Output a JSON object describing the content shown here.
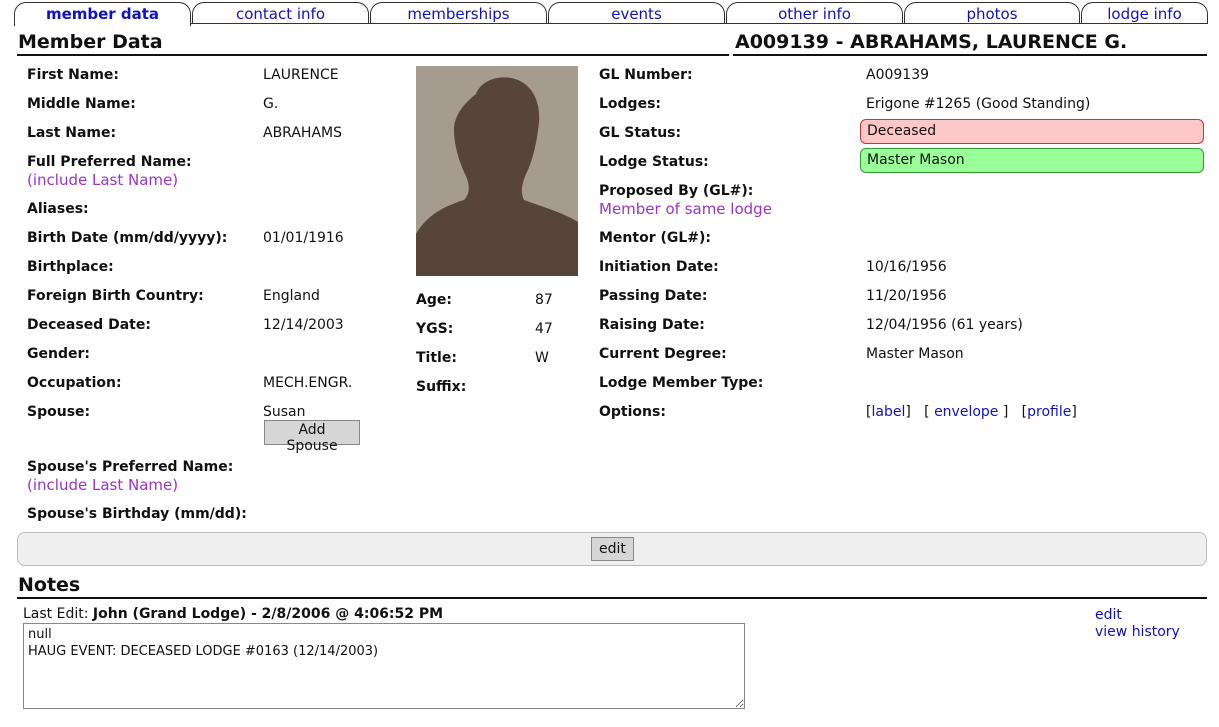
{
  "tabs": [
    {
      "label": "member data",
      "active": true
    },
    {
      "label": "contact info",
      "active": false
    },
    {
      "label": "memberships",
      "active": false
    },
    {
      "label": "events",
      "active": false
    },
    {
      "label": "other info",
      "active": false
    },
    {
      "label": "photos",
      "active": false
    },
    {
      "label": "lodge info",
      "active": false
    }
  ],
  "header": {
    "section_title": "Member Data",
    "member_title": "A009139 - ABRAHAMS, LAURENCE G."
  },
  "left": {
    "first_name_label": "First Name:",
    "first_name": "LAURENCE",
    "middle_name_label": "Middle Name:",
    "middle_name": "G.",
    "last_name_label": "Last Name:",
    "last_name": "ABRAHAMS",
    "full_pref_label": "Full Preferred Name:",
    "full_pref_hint": "(include Last Name)",
    "aliases_label": "Aliases:",
    "birth_date_label": "Birth Date (mm/dd/yyyy):",
    "birth_date": "01/01/1916",
    "birthplace_label": "Birthplace:",
    "foreign_country_label": "Foreign Birth Country:",
    "foreign_country": "England",
    "deceased_label": "Deceased Date:",
    "deceased_date": "12/14/2003",
    "gender_label": "Gender:",
    "occupation_label": "Occupation:",
    "occupation": "MECH.ENGR.",
    "spouse_label": "Spouse:",
    "spouse": "Susan",
    "add_spouse_button": "Add Spouse",
    "spouse_pref_label": "Spouse's Preferred Name:",
    "spouse_pref_hint": "(include Last Name)",
    "spouse_bday_label": "Spouse's Birthday (mm/dd):"
  },
  "middle": {
    "age_label": "Age:",
    "age": "87",
    "ygs_label": "YGS:",
    "ygs": "47",
    "title_label": "Title:",
    "title": "W",
    "suffix_label": "Suffix:"
  },
  "right": {
    "gl_number_label": "GL Number:",
    "gl_number": "A009139",
    "lodges_label": "Lodges:",
    "lodges": "Erigone #1265 (Good Standing)",
    "gl_status_label": "GL Status:",
    "gl_status": "Deceased",
    "lodge_status_label": "Lodge Status:",
    "lodge_status": "Master Mason",
    "proposed_label": "Proposed By (GL#):",
    "proposed_hint": "Member of same lodge",
    "mentor_label": "Mentor (GL#):",
    "initiation_label": "Initiation Date:",
    "initiation": "10/16/1956",
    "passing_label": "Passing Date:",
    "passing": "11/20/1956",
    "raising_label": "Raising Date:",
    "raising": "12/04/1956 (61 years)",
    "degree_label": "Current Degree:",
    "degree": "Master Mason",
    "member_type_label": "Lodge Member Type:",
    "options_label": "Options:",
    "option_label": "label",
    "option_envelope": "envelope",
    "option_profile": "profile"
  },
  "edit_button": "edit",
  "notes": {
    "title": "Notes",
    "last_edit_label": "Last Edit:",
    "last_edit_value": "John (Grand Lodge) - 2/8/2006 @ 4:06:52 PM",
    "text_line1": "null",
    "text_line2": "HAUG EVENT: DECEASED LODGE #0163 (12/14/2003)",
    "edit_link": "edit",
    "history_link": "view history"
  },
  "colors": {
    "tab_text": "#1010cc",
    "hint": "#9933cc",
    "deceased_bg": "#ffc8c8",
    "master_bg": "#99ff99"
  }
}
